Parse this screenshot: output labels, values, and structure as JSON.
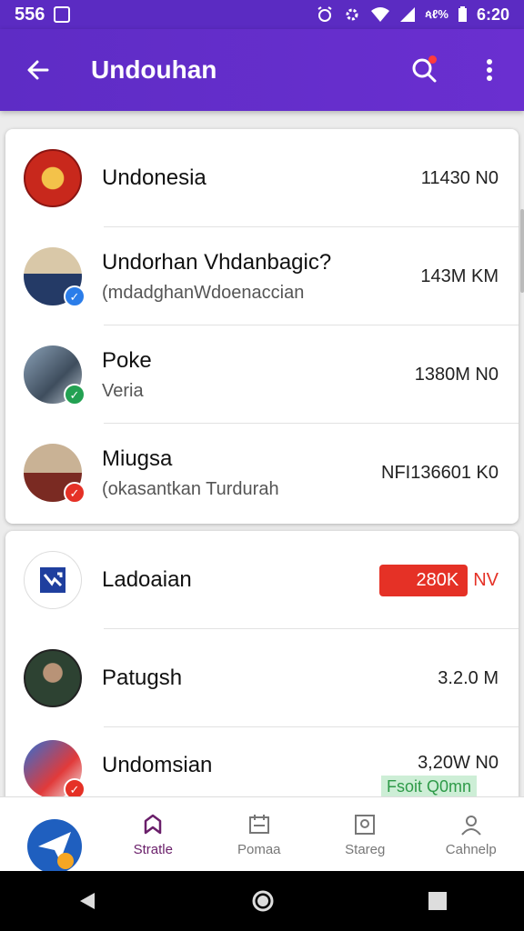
{
  "status_bar": {
    "left_text": "556",
    "signal_text": "ጳℓ%",
    "time": "6:20"
  },
  "app_bar": {
    "title": "Undouhan"
  },
  "list_top": [
    {
      "name": "Undonesia",
      "subtitle": "",
      "value": "11430 N0",
      "badge": ""
    },
    {
      "name": "Undorhan Vhdanbagic?",
      "subtitle": "(mdadghanWdoenaccian",
      "value": "143M KM",
      "badge": "✓"
    },
    {
      "name": "Poke",
      "subtitle": "Veria",
      "value": "1380M N0",
      "badge": "✓"
    },
    {
      "name": "Miugsa",
      "subtitle": "(okasantkan Turdurah",
      "value": "NFI136601 K0",
      "badge": "✓"
    }
  ],
  "list_bottom": [
    {
      "name": "Ladoaian",
      "value": "280K",
      "unit": "NV"
    },
    {
      "name": "Patugsh",
      "value": "3.2.0 M"
    },
    {
      "name": "Undomsian",
      "value": "3,20W N0",
      "tag": "Fsoit Q0mn"
    }
  ],
  "bottom_nav": [
    {
      "label": "Stratle",
      "icon": "bookmark-icon",
      "active": true
    },
    {
      "label": "Pomaa",
      "icon": "calendar-icon",
      "active": false
    },
    {
      "label": "Stareg",
      "icon": "frame-icon",
      "active": false
    },
    {
      "label": "Cahnelp",
      "icon": "person-icon",
      "active": false
    }
  ],
  "colors": {
    "primary": "#5e2cc5",
    "accent_red": "#e53126",
    "badge_blue": "#2b7de9",
    "badge_green": "#23a152"
  }
}
